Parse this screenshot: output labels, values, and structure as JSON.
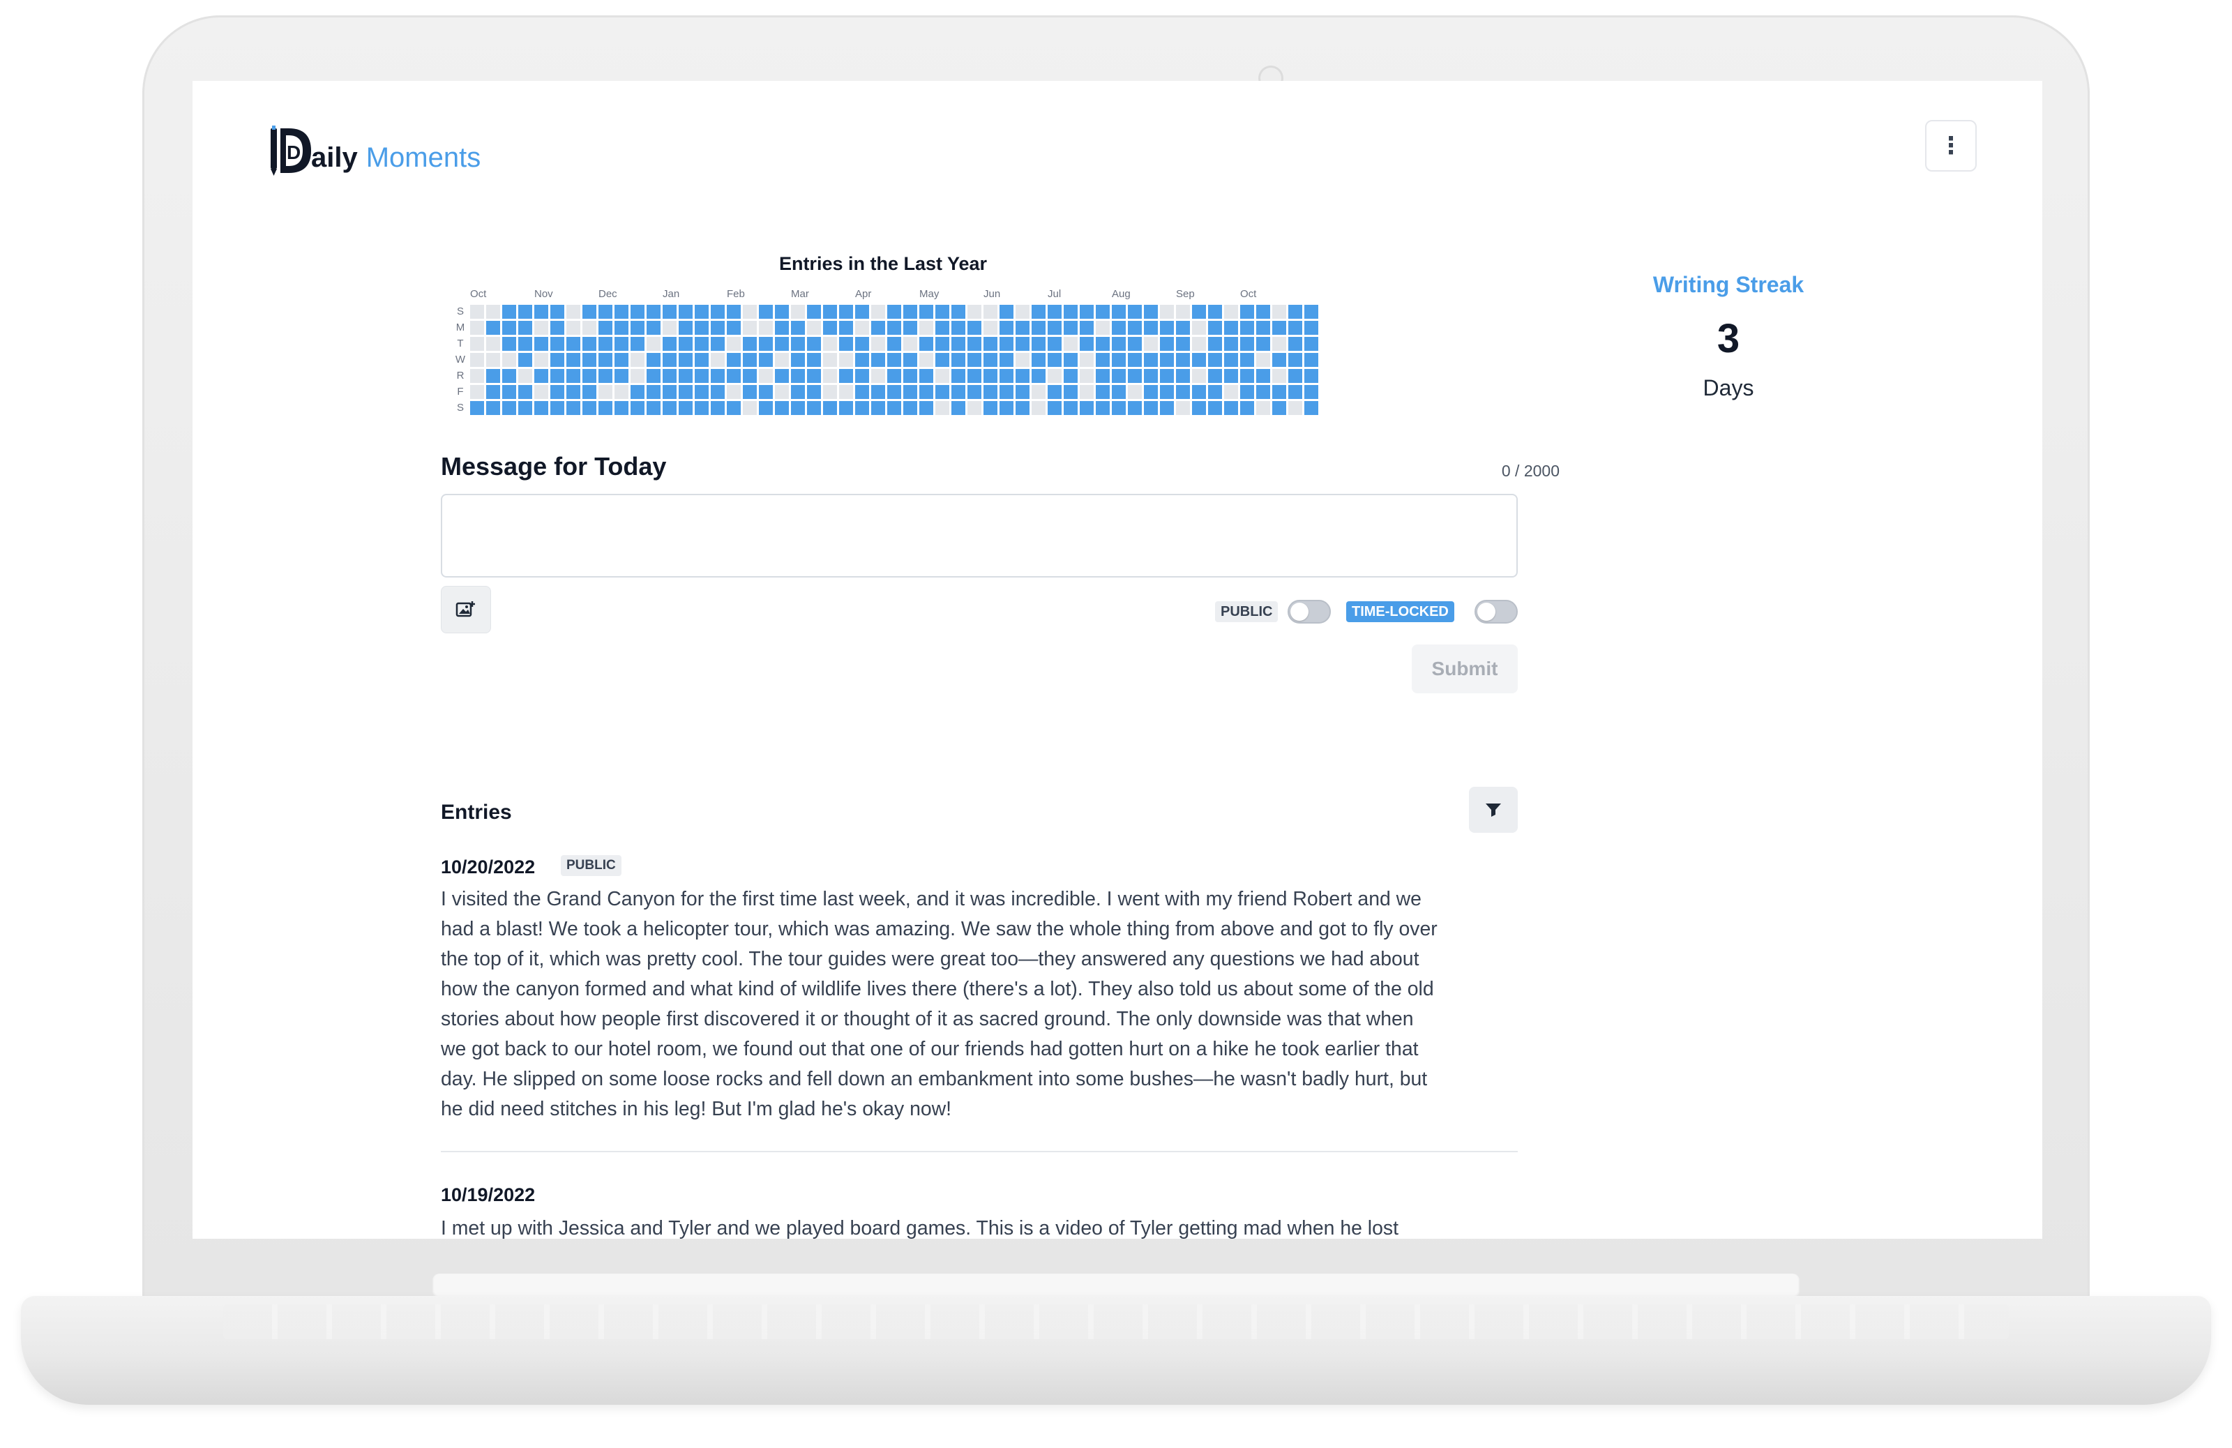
{
  "app": {
    "logo_initial": "D",
    "logo_part1": "aily",
    "logo_part2": "Moments",
    "accent_color": "#4a9de8"
  },
  "header": {
    "menu_icon": "vertical-dots-icon",
    "menu_glyph": "⋮"
  },
  "heatmap": {
    "title": "Entries in the Last Year",
    "months": [
      "Oct",
      "Nov",
      "Dec",
      "Jan",
      "Feb",
      "Mar",
      "Apr",
      "May",
      "Jun",
      "Jul",
      "Aug",
      "Sep",
      "Oct"
    ],
    "days": [
      "S",
      "M",
      "T",
      "W",
      "R",
      "F",
      "S"
    ],
    "filled_color": "#4a9de8",
    "empty_color": "#e3e6ea",
    "weeks": 53,
    "grid": [
      "0011110111111111101101111011111001011111111001101101111",
      "0111010011110111100110110111011101111110111110111111110",
      "0011111111101111011111011010111111111011110110111101111",
      "0001011111011110111011001111011111011101111111111011101",
      "0110111111011111110111011011101111110101111110111101111",
      "0111011100111111011011001111111111101101101111101111111",
      "1111111111111111101111111111101011101111111101111010110"
    ]
  },
  "streak": {
    "title": "Writing Streak",
    "count": "3",
    "unit": "Days"
  },
  "composer": {
    "heading": "Message for Today",
    "char_count": "0 / 2000",
    "message_value": "",
    "image_icon": "add-image-icon",
    "public_label": "PUBLIC",
    "public_on": false,
    "timelocked_label": "TIME-LOCKED",
    "timelocked_on": false,
    "submit_label": "Submit"
  },
  "entries": {
    "heading": "Entries",
    "filter_icon": "filter-icon",
    "items": [
      {
        "date": "10/20/2022",
        "badge": "PUBLIC",
        "lines": [
          "I visited the Grand Canyon for the first time last week, and it was incredible. I went with my friend Robert and we",
          "had a blast! We took a helicopter tour, which was amazing. We saw the whole thing from above and got to fly over",
          "the top of it, which was pretty cool. The tour guides were great too—they answered any questions we had about",
          "how the canyon formed and what kind of wildlife lives there (there's a lot). They also told us about some of the old",
          "stories about how people first discovered it or thought of it as sacred ground. The only downside was that when",
          "we got back to our hotel room, we found out that one of our friends had gotten hurt on a hike he took earlier that",
          "day. He slipped on some loose rocks and fell down an embankment into some bushes—he wasn't badly hurt, but",
          "he did need stitches in his leg! But I'm glad he's okay now!"
        ]
      },
      {
        "date": "10/19/2022",
        "badge": "",
        "lines": [
          "I met up with Jessica and Tyler and we played board games. This is a video of Tyler getting mad when he lost"
        ]
      }
    ]
  }
}
